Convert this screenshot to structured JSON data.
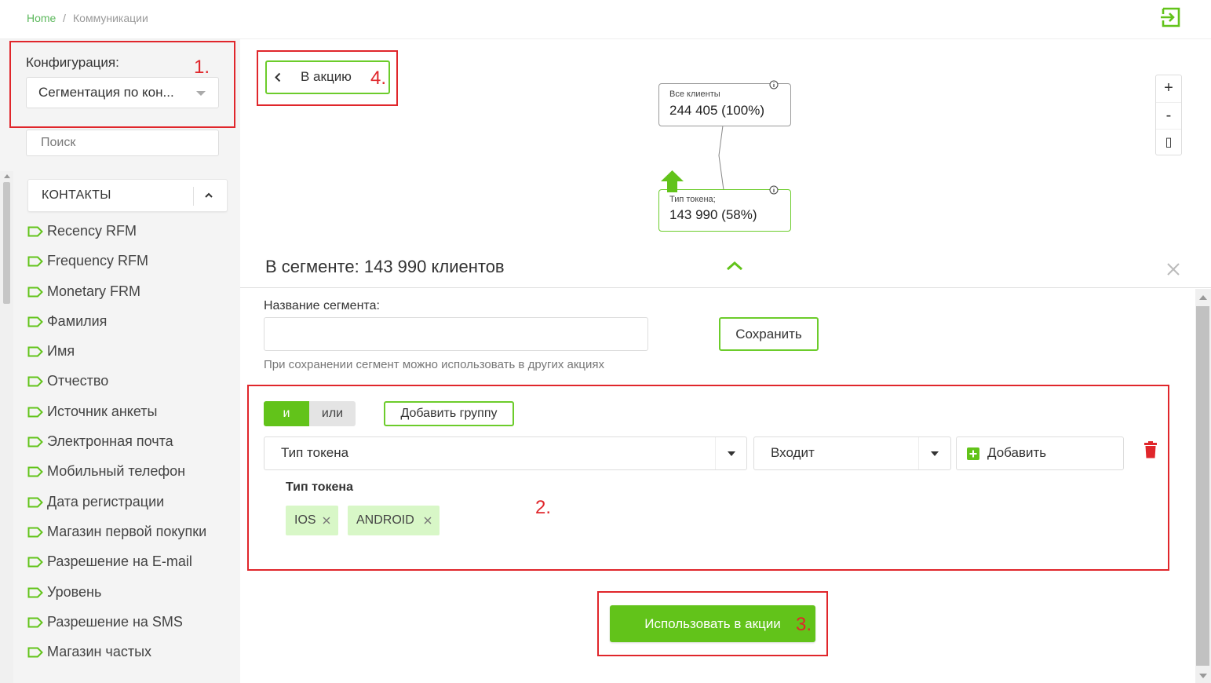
{
  "breadcrumb": {
    "home": "Home",
    "separator": "/",
    "current": "Коммуникации"
  },
  "sidebar": {
    "config_label": "Конфигурация:",
    "config_value": "Сегментация по кон...",
    "search_placeholder": "Поиск",
    "section_title": "КОНТАКТЫ",
    "items": [
      "Recency RFM",
      "Frequency RFM",
      "Monetary FRM",
      "Фамилия",
      "Имя",
      "Отчество",
      "Источник анкеты",
      "Электронная почта",
      "Мобильный телефон",
      "Дата регистрации",
      "Магазин первой покупки",
      "Разрешение на E-mail",
      "Уровень",
      "Разрешение на SMS",
      "Магазин частых"
    ]
  },
  "graph": {
    "back_label": "В акцию",
    "root": {
      "caption": "Все клиенты",
      "value": "244 405 (100%)"
    },
    "child": {
      "caption": "Тип токена;",
      "value": "143 990 (58%)"
    },
    "zoom": {
      "in": "+",
      "out": "-",
      "fit": "▯"
    }
  },
  "segment": {
    "title": "В сегменте: 143 990 клиентов",
    "name_label": "Название сегмента:",
    "name_value": "",
    "save_label": "Сохранить",
    "hint": "При сохранении сегмент можно использовать в других акциях",
    "logic_and": "и",
    "logic_or": "или",
    "add_group_label": "Добавить группу",
    "condition": {
      "field": "Тип токена",
      "operator": "Входит",
      "add_label": "Добавить",
      "group_field_label": "Тип токена",
      "values": [
        "IOS",
        "ANDROID"
      ]
    },
    "use_label": "Использовать в акции"
  },
  "annotations": [
    "1.",
    "2.",
    "3.",
    "4."
  ],
  "colors": {
    "accent": "#62c31a",
    "accent_border": "#6ccc2b",
    "annotation": "#e0262b",
    "chip_bg": "#d8f7c7",
    "trash": "#e0262b"
  }
}
